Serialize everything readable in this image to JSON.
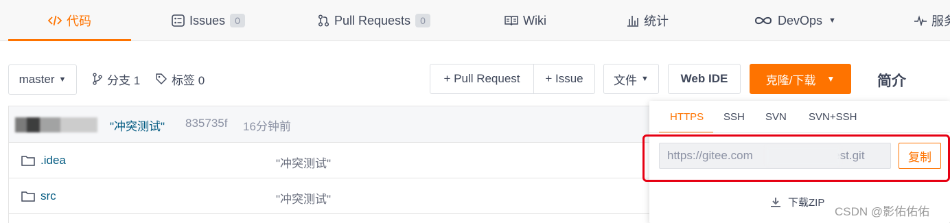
{
  "tabs": [
    {
      "label": "代码",
      "icon": "code-icon",
      "active": true
    },
    {
      "label": "Issues",
      "badge": "0",
      "icon": "issues-icon"
    },
    {
      "label": "Pull Requests",
      "badge": "0",
      "icon": "pull-request-icon"
    },
    {
      "label": "Wiki",
      "icon": "wiki-book-icon"
    },
    {
      "label": "统计",
      "icon": "stats-bar-icon"
    },
    {
      "label": "DevOps",
      "icon": "infinity-icon"
    },
    {
      "label": "服务",
      "icon": "pulse-icon"
    }
  ],
  "toolbar": {
    "branch": "master",
    "branches": "分支 1",
    "tags": "标签 0",
    "pull_request": "+ Pull Request",
    "issue": "+ Issue",
    "file": "文件",
    "web_ide": "Web IDE",
    "clone_download": "克隆/下载"
  },
  "sidebar_title": "简介",
  "latest_commit": {
    "message": "\"冲突测试\"",
    "sha": "835735f",
    "time": "16分钟前"
  },
  "files": [
    {
      "name": ".idea",
      "commit": "\"冲突测试\""
    },
    {
      "name": "src",
      "commit": "\"冲突测试\""
    }
  ],
  "clone": {
    "protocols": [
      "HTTPS",
      "SSH",
      "SVN",
      "SVN+SSH"
    ],
    "active_protocol": "HTTPS",
    "url_prefix": "https://gitee.com",
    "url_suffix": "/test.git",
    "copy": "复制",
    "download_zip": "下载ZIP"
  },
  "watermark": "CSDN @影佑佑佑",
  "colors": {
    "accent": "#fe7300",
    "link": "#005980",
    "highlight": "#e60012"
  }
}
